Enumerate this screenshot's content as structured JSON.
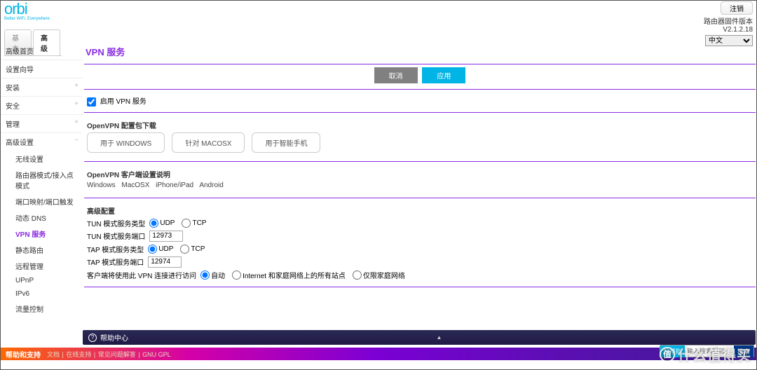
{
  "header": {
    "brand": "orbi",
    "tagline": "Better WiFi. Everywhere",
    "logout": "注销",
    "fw_label": "路由器固件版本",
    "fw_version": "V2.1.2.18",
    "lang_selected": "中文"
  },
  "tabs": {
    "basic": "基本",
    "advanced": "高级"
  },
  "sidebar": {
    "items": [
      {
        "label": "高级首页"
      },
      {
        "label": "设置向导"
      },
      {
        "label": "安装",
        "expandable": true
      },
      {
        "label": "安全",
        "expandable": true
      },
      {
        "label": "管理",
        "expandable": true
      },
      {
        "label": "高级设置",
        "expandable": true,
        "expanded": true
      }
    ],
    "sub": [
      {
        "label": "无线设置"
      },
      {
        "label": "路由器模式/接入点模式"
      },
      {
        "label": "端口映射/端口触发"
      },
      {
        "label": "动态 DNS"
      },
      {
        "label": "VPN 服务",
        "active": true
      },
      {
        "label": "静态路由"
      },
      {
        "label": "远程管理"
      },
      {
        "label": "UPnP"
      },
      {
        "label": "IPv6"
      },
      {
        "label": "流量控制"
      }
    ]
  },
  "main": {
    "title": "VPN 服务",
    "cancel": "取消",
    "apply": "应用",
    "enable_label": "启用 VPN 服务",
    "download_heading": "OpenVPN 配置包下载",
    "dl_windows": "用于 WINDOWS",
    "dl_macosx": "针对 MACOSX",
    "dl_mobile": "用于智能手机",
    "instructions_heading": "OpenVPN 客户端设置说明",
    "platforms": [
      "Windows",
      "MacOSX",
      "iPhone/iPad",
      "Android"
    ],
    "adv_heading": "高级配置",
    "tun_type_label": "TUN 模式服务类型",
    "tun_port_label": "TUN 模式服务端口",
    "tun_port_value": "12973",
    "tap_type_label": "TAP 模式服务类型",
    "tap_port_label": "TAP 模式服务端口",
    "tap_port_value": "12974",
    "udp": "UDP",
    "tcp": "TCP",
    "access_label": "客户端将使用此 VPN 连接进行访问",
    "access_opts": [
      "自动",
      "Internet 和家庭网络上的所有站点",
      "仅限家庭网络"
    ]
  },
  "help": {
    "title": "帮助中心"
  },
  "footer": {
    "support": "帮助和支持",
    "links": [
      "文档",
      "在线支持",
      "常见问题解答",
      "GNU GPL"
    ]
  },
  "overlay": {
    "watermark_badge": "值",
    "watermark_text": "什么值得买",
    "search_label": "我帮助",
    "search_placeholder": "输入搜索项目",
    "search_go": "搜索"
  }
}
